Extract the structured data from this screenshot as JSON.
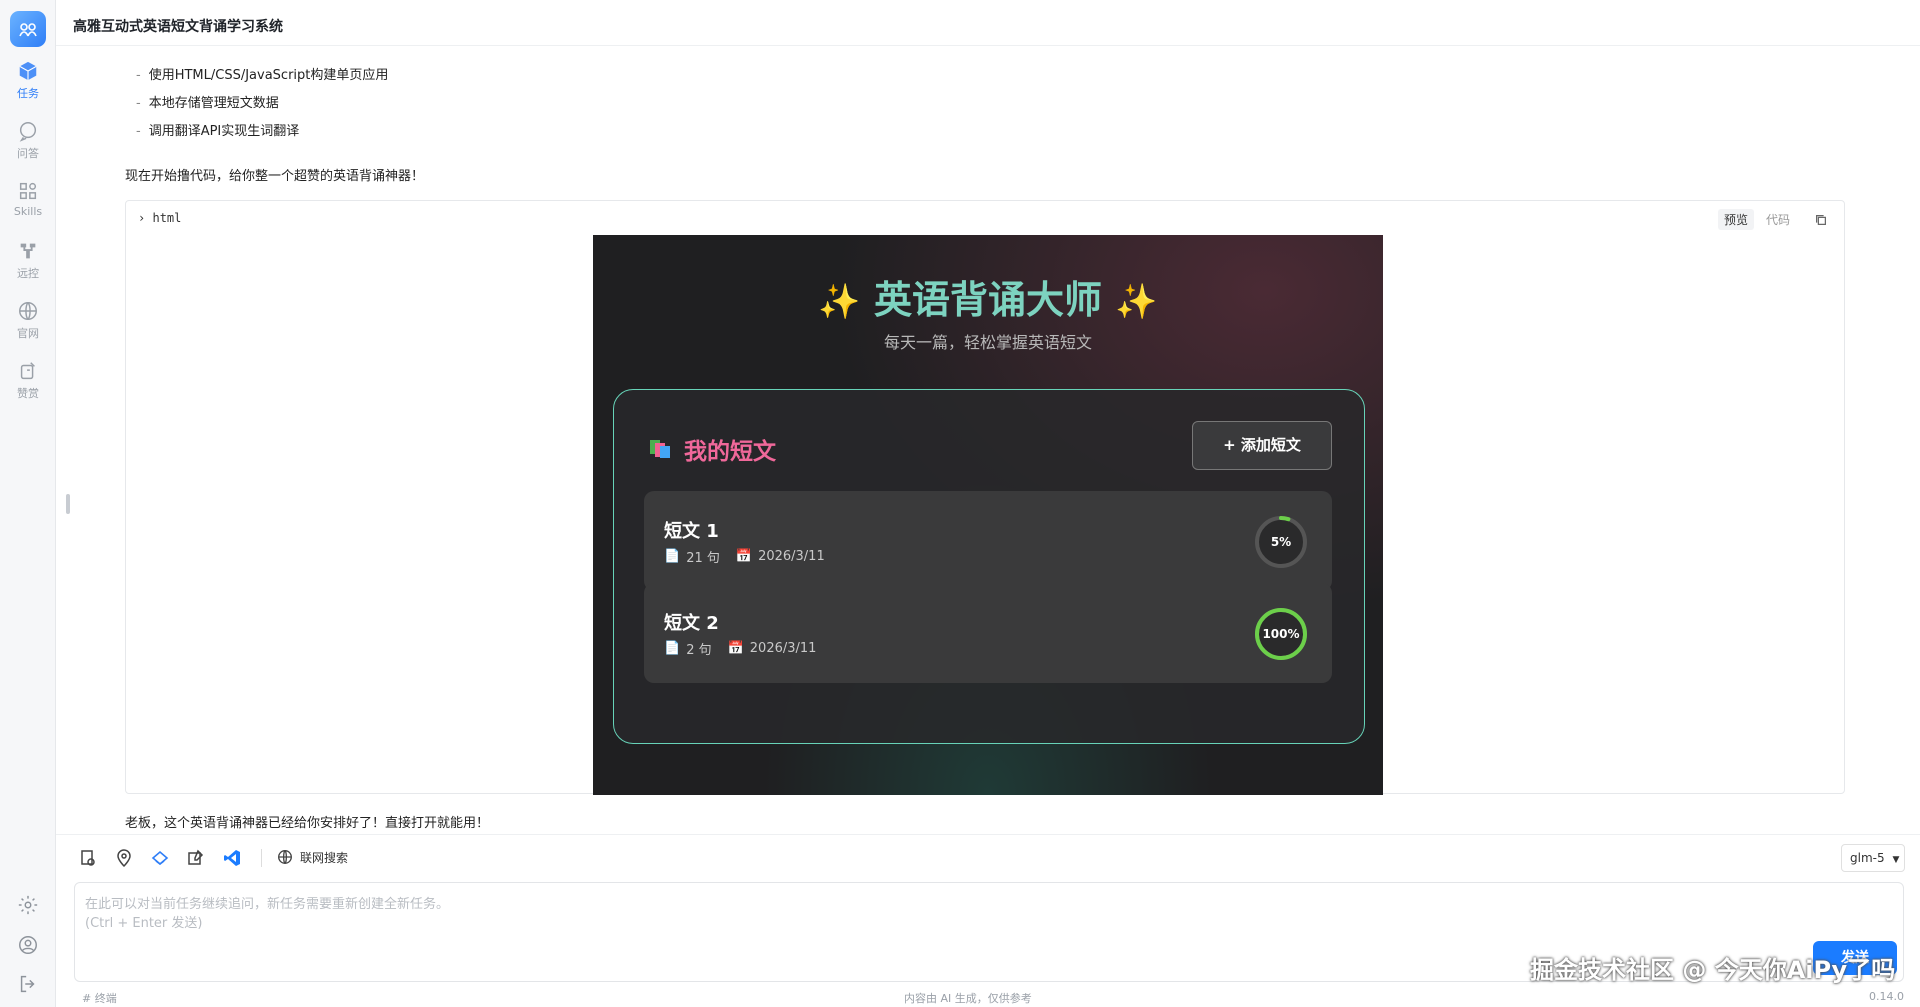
{
  "app": {
    "title": "高雅互动式英语短文背诵学习系统"
  },
  "rail": {
    "items": [
      {
        "label": "任务",
        "icon": "cube-icon",
        "active": true
      },
      {
        "label": "问答",
        "icon": "chat-icon",
        "active": false
      },
      {
        "label": "Skills",
        "icon": "grid-icon",
        "active": false
      },
      {
        "label": "远控",
        "icon": "remote-icon",
        "active": false
      },
      {
        "label": "官网",
        "icon": "globe-icon",
        "active": false
      },
      {
        "label": "赞赏",
        "icon": "reward-icon",
        "active": false
      }
    ]
  },
  "chat": {
    "bullets": [
      "使用HTML/CSS/JavaScript构建单页应用",
      "本地存储管理短文数据",
      "调用翻译API实现生词翻译"
    ],
    "intro": "现在开始撸代码，给你整一个超赞的英语背诵神器！",
    "outro": "老板，这个英语背诵神器已经给你安排好了！直接打开就能用！"
  },
  "code_block": {
    "lang": "html",
    "tab_preview": "预览",
    "tab_code": "代码"
  },
  "preview": {
    "title": "英语背诵大师",
    "subtitle": "每天一篇，轻松掌握英语短文",
    "panel_title": "我的短文",
    "add_button": "+ 添加短文",
    "cards": [
      {
        "title": "短文 1",
        "sentences": "21 句",
        "date": "2026/3/11",
        "progress": 5,
        "progress_label": "5%"
      },
      {
        "title": "短文 2",
        "sentences": "2 句",
        "date": "2026/3/11",
        "progress": 100,
        "progress_label": "100%"
      }
    ],
    "colors": {
      "accent": "#7dd3c0",
      "panel_border": "#67d3b8",
      "panel_title": "#f0689a",
      "ring": "#6ccf4a"
    }
  },
  "toolbar": {
    "web_search": "联网搜索",
    "model": "glm-5"
  },
  "input": {
    "placeholder": "在此可以对当前任务继续追问，新任务需要重新创建全新任务。\n(Ctrl + Enter 发送)",
    "send_label": "发送"
  },
  "footer": {
    "left": "# 终端",
    "center": "内容由 AI 生成，仅供参考",
    "version": "0.14.0"
  },
  "watermark": "掘金技术社区 @ 今天你AiPy了吗"
}
